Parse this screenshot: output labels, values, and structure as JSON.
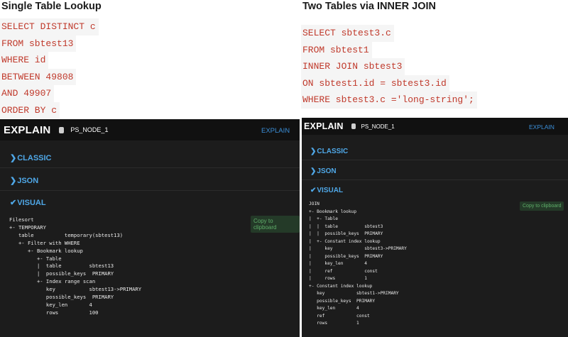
{
  "left": {
    "title": "Single Table Lookup",
    "sql": [
      "SELECT DISTINCT c",
      "FROM sbtest13",
      "WHERE id",
      "BETWEEN 49808",
      "AND 49907",
      "ORDER BY c"
    ],
    "panel": {
      "header": "EXPLAIN",
      "node": "PS_NODE_1",
      "explain_link": "EXPLAIN",
      "sections": [
        "CLASSIC",
        "JSON",
        "VISUAL"
      ],
      "copy_label": "Copy to clipboard",
      "plan": [
        "Filesort",
        "+- TEMPORARY",
        "   table          temporary(sbtest13)",
        "   +- Filter with WHERE",
        "      +- Bookmark lookup",
        "         +- Table",
        "         |  table         sbtest13",
        "         |  possible_keys  PRIMARY",
        "         +- Index range scan",
        "            key           sbtest13->PRIMARY",
        "            possible_keys  PRIMARY",
        "            key_len       4",
        "            rows          100"
      ]
    }
  },
  "right": {
    "title": "Two Tables via INNER JOIN",
    "sql": [
      "SELECT sbtest3.c",
      "FROM sbtest1",
      "INNER JOIN sbtest3",
      "ON sbtest1.id = sbtest3.id",
      "WHERE sbtest3.c ='long-string';"
    ],
    "panel": {
      "header": "EXPLAIN",
      "node": "PS_NODE_1",
      "explain_link": "EXPLAIN",
      "sections": [
        "CLASSIC",
        "JSON",
        "VISUAL"
      ],
      "copy_label": "Copy to clipboard",
      "plan": [
        "JOIN",
        "+- Bookmark lookup",
        "|  +- Table",
        "|  |  table          sbtest3",
        "|  |  possible_keys  PRIMARY",
        "|  +- Constant index lookup",
        "|     key            sbtest3->PRIMARY",
        "|     possible_keys  PRIMARY",
        "|     key_len        4",
        "|     ref            const",
        "|     rows           1",
        "+- Constant index lookup",
        "   key            sbtest1->PRIMARY",
        "   possible_keys  PRIMARY",
        "   key_len        4",
        "   ref            const",
        "   rows           1"
      ]
    }
  },
  "colors": {
    "link": "#3b8fd9",
    "sql": "#c0392b",
    "copy": "#5fae6a"
  },
  "icons": {
    "database": "database-icon",
    "chevron_right": "chevron-right-icon",
    "chevron_down": "chevron-down-icon"
  }
}
